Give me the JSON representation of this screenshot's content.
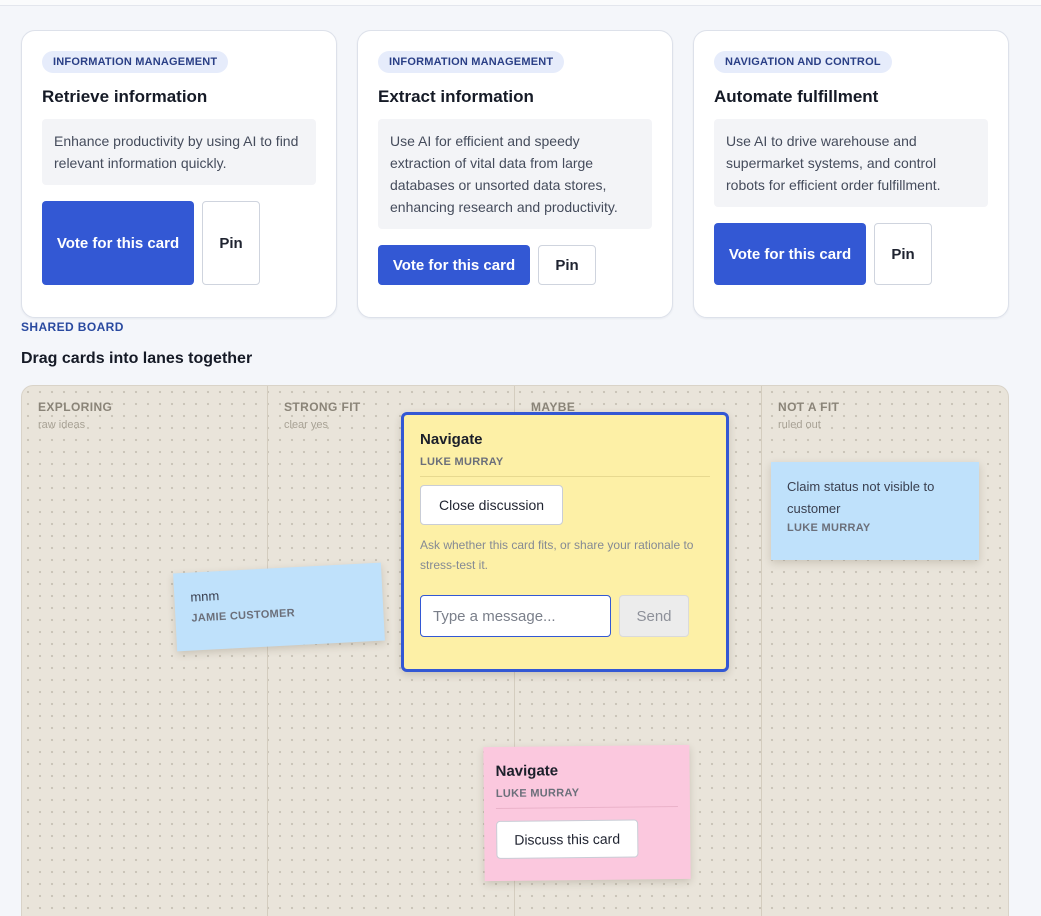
{
  "cards": [
    {
      "tag": "INFORMATION MANAGEMENT",
      "title": "Retrieve information",
      "description": "Enhance productivity by using AI to find relevant information quickly.",
      "vote_label": "Vote for this card",
      "pin_label": "Pin"
    },
    {
      "tag": "INFORMATION MANAGEMENT",
      "title": "Extract information",
      "description": "Use AI for efficient and speedy extraction of vital data from large databases or unsorted data stores, enhancing research and productivity.",
      "vote_label": "Vote for this card",
      "pin_label": "Pin"
    },
    {
      "tag": "NAVIGATION AND CONTROL",
      "title": "Automate fulfillment",
      "description": "Use AI to drive warehouse and supermarket systems, and control robots for efficient order fulfillment.",
      "vote_label": "Vote for this card",
      "pin_label": "Pin"
    }
  ],
  "board": {
    "eyebrow": "SHARED BOARD",
    "title": "Drag cards into lanes together",
    "lanes": [
      {
        "name": "EXPLORING",
        "sub": "raw ideas"
      },
      {
        "name": "STRONG FIT",
        "sub": "clear yes"
      },
      {
        "name": "MAYBE",
        "sub": ""
      },
      {
        "name": "NOT A FIT",
        "sub": "ruled out"
      }
    ],
    "stickies": {
      "mnm": {
        "text": "mnm",
        "author": "JAMIE CUSTOMER",
        "color": "#bfe1fb"
      },
      "claim": {
        "text": "Claim status not visible to customer",
        "author": "LUKE MURRAY",
        "color": "#bfe1fb"
      },
      "nav_open": {
        "title": "Navigate",
        "author": "LUKE MURRAY",
        "close_label": "Close discussion",
        "hint": "Ask whether this card fits, or share your rationale to stress-test it.",
        "input_placeholder": "Type a message...",
        "send_label": "Send",
        "color": "#fdf0a6"
      },
      "nav_pink": {
        "title": "Navigate",
        "author": "LUKE MURRAY",
        "discuss_label": "Discuss this card",
        "color": "#fbc8de"
      }
    }
  },
  "colors": {
    "accent": "#3358d4",
    "page_bg": "#f4f6fa",
    "board_bg": "#e9e4da"
  }
}
